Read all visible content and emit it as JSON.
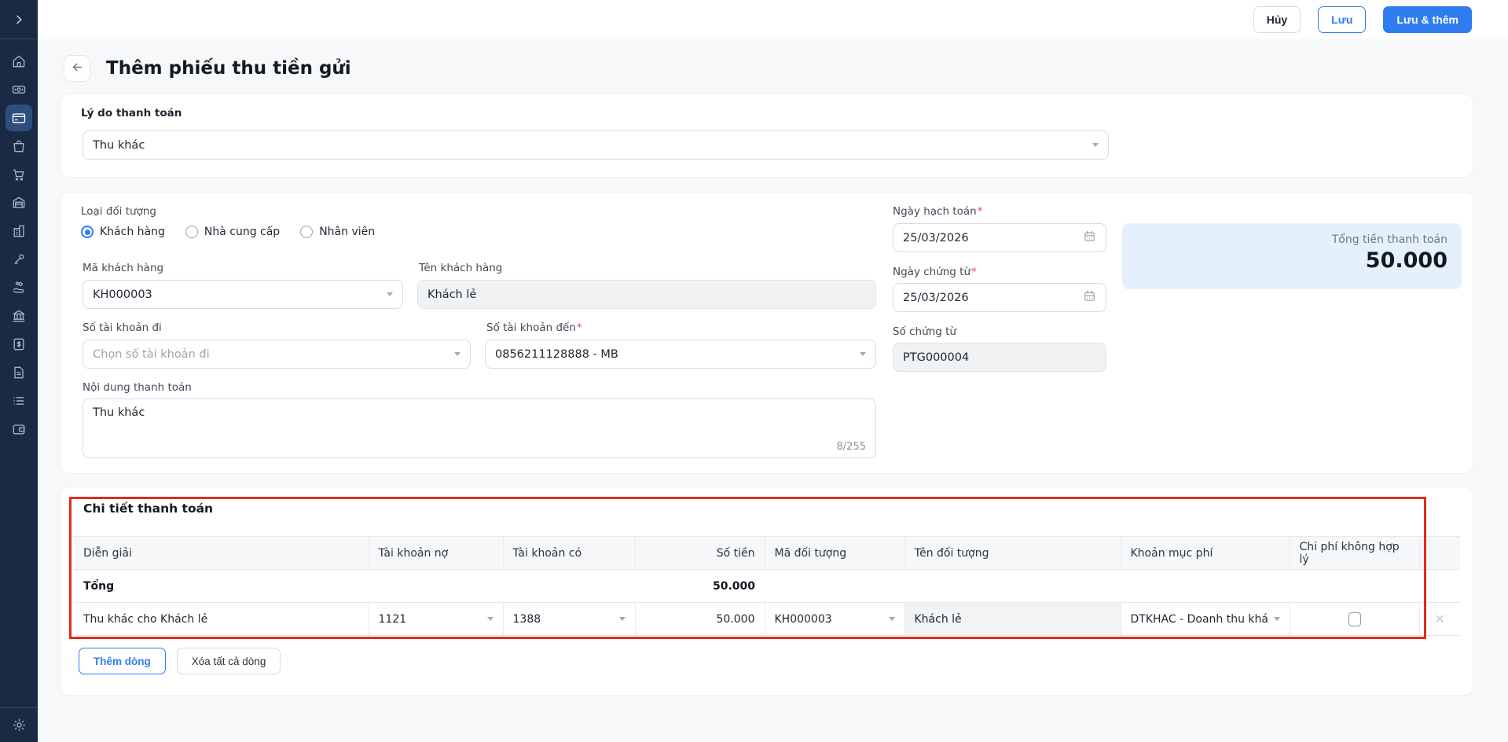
{
  "topbar": {
    "cancel_label": "Hủy",
    "save_label": "Lưu",
    "save_add_label": "Lưu & thêm"
  },
  "page": {
    "title": "Thêm phiếu thu tiền gửi",
    "back_icon": "arrow-left-icon"
  },
  "sidebar": {
    "expand_icon": "chevron-right-icon",
    "settings_icon": "gear-icon",
    "items": [
      {
        "icon": "home-icon",
        "active": false
      },
      {
        "icon": "cash-icon",
        "active": false
      },
      {
        "icon": "card-icon",
        "active": true
      },
      {
        "icon": "bag-icon",
        "active": false
      },
      {
        "icon": "cart-icon",
        "active": false
      },
      {
        "icon": "warehouse-icon",
        "active": false
      },
      {
        "icon": "building-icon",
        "active": false
      },
      {
        "icon": "tool-icon",
        "active": false
      },
      {
        "icon": "hand-coin-icon",
        "active": false
      },
      {
        "icon": "bank-icon",
        "active": false
      },
      {
        "icon": "invoice-icon",
        "active": false
      },
      {
        "icon": "document-icon",
        "active": false
      },
      {
        "icon": "list-icon",
        "active": false
      },
      {
        "icon": "wallet-icon",
        "active": false
      }
    ]
  },
  "reason": {
    "label": "Lý do thanh toán",
    "value": "Thu khác"
  },
  "info": {
    "object_type_label": "Loại đối tượng",
    "object_types": [
      {
        "label": "Khách hàng",
        "selected": true
      },
      {
        "label": "Nhà cung cấp",
        "selected": false
      },
      {
        "label": "Nhân viên",
        "selected": false
      }
    ],
    "customer_code_label": "Mã khách hàng",
    "customer_code_value": "KH000003",
    "customer_name_label": "Tên khách hàng",
    "customer_name_value": "Khách lẻ",
    "account_from_label": "Số tài khoản đi",
    "account_from_placeholder": "Chọn số tài khoản đi",
    "account_to_label": "Số tài khoản đến",
    "account_to_value": "0856211128888 - MB",
    "content_label": "Nội dung thanh toán",
    "content_value": "Thu khác",
    "content_counter": "8/255",
    "posting_date_label": "Ngày hạch toán",
    "posting_date_value": "25/03/2026",
    "doc_date_label": "Ngày chứng từ",
    "doc_date_value": "25/03/2026",
    "doc_no_label": "Số chứng từ",
    "doc_no_value": "PTG000004",
    "required_mark": "*",
    "total_box": {
      "label": "Tổng tiền thanh toán",
      "value": "50.000"
    }
  },
  "details": {
    "title": "Chi tiết thanh toán",
    "headers": [
      "Diễn giải",
      "Tài khoản nợ",
      "Tài khoản có",
      "Số tiền",
      "Mã đối tượng",
      "Tên đối tượng",
      "Khoản mục phí",
      "Chi phí không hợp lý"
    ],
    "total_row": {
      "label": "Tổng",
      "amount": "50.000"
    },
    "rows": [
      {
        "description": "Thu khác cho Khách lẻ",
        "debit_account": "1121",
        "credit_account": "1388",
        "amount": "50.000",
        "object_code": "KH000003",
        "object_name": "Khách lẻ",
        "fee_category": "DTKHAC - Doanh thu khá",
        "invalid_expense": false
      }
    ],
    "add_row_label": "Thêm dòng",
    "delete_all_label": "Xóa tất cả dòng",
    "delete_row_icon": "close-icon"
  },
  "colors": {
    "accent": "#2e7cf0",
    "sidebar": "#1b2a44",
    "annotation": "#e02b20",
    "total_box_bg": "#e4f1fd"
  }
}
